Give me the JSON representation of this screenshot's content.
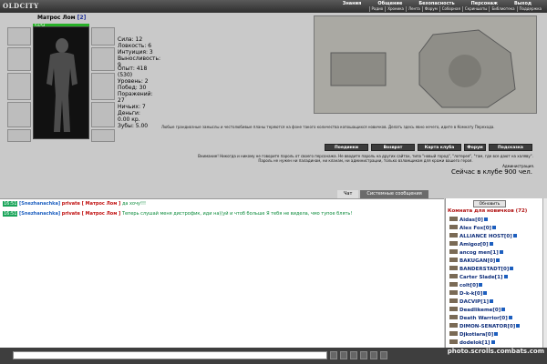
{
  "brand": "OLDCITY",
  "topnav": [
    "Знания",
    "Общение",
    "Безопасность",
    "Персонаж",
    "Выход"
  ],
  "subnav": [
    "Радио",
    "Хроника",
    "Лента",
    "Форум",
    "Соборная",
    "Скриншоты",
    "Библиотека",
    "Поддержка"
  ],
  "character": {
    "name": "Матрос Лом",
    "level": "[2]",
    "hp": "54/54",
    "stats": [
      "Сила: 12",
      "Ловкость: 6",
      "Интуиция: 3",
      "Выносливость: 9"
    ],
    "stats2": [
      "Опыт: 418 (530)",
      "Уровень: 2",
      "Побед: 30",
      "Поражений: 27",
      "Ничьих: 7",
      "Деньги: 0.00 кр.",
      "Зубы: 5.00"
    ]
  },
  "map_caption": "Любые грандиозные замыслы и честолюбивые планы теряются на фоне такого количества копошащихся новичков. Делать здесь явно нечего, идите в Комнату Перехода.",
  "buttons": [
    "Поединки",
    "Возврат",
    "Карта клуба",
    "Форум",
    "Подсказка"
  ],
  "warning": "Внимание! Никогда и никому не говорите пароль от своего персонажа. Не вводите пароль на других сайтах, типа \"новый город\", \"лотерея\", \"там, где все дают на халяву\". Пароль не нужен ни паладинам, ни кланам, ни администрации, только взломщикам для кражи вашего героя.",
  "admin_label": "Администрация.",
  "online": "Сейчас в клубе 900 чел.",
  "tabs": [
    "Чат",
    "Системные сообщения"
  ],
  "chat": [
    {
      "time": "16:51",
      "nick": "[Snezhanachka]",
      "private": "private [ Матрос Лом ]",
      "text": "да хочу!!!"
    },
    {
      "time": "16:51",
      "nick": "[Snezhanachka]",
      "private": "private [ Матрос Лом ]",
      "text": "Теперь слушай меня дистрофик, иди на)(уй и чтоб больше Я тебя не видела, чмо тупое блять!"
    }
  ],
  "refresh_label": "Обновить",
  "room_title": "Комната для новичков (72)",
  "players": [
    "Aidas[0]",
    "Alex Fox[0]",
    "ALLIANCE HOST[0]",
    "Amigoz[0]",
    "ancog men[1]",
    "BAKUGAN[0]",
    "BANDERSTADT[0]",
    "Carter Slade[1]",
    "colt[0]",
    "D-k-k[0]",
    "DACVIP[1]",
    "Deadlikeme[0]",
    "Death Warrior[0]",
    "DIMON-SENATOR[0]",
    "Djkotiara[0]",
    "dodelok[1]"
  ],
  "watermark": "photo.scrolls.combats.com"
}
